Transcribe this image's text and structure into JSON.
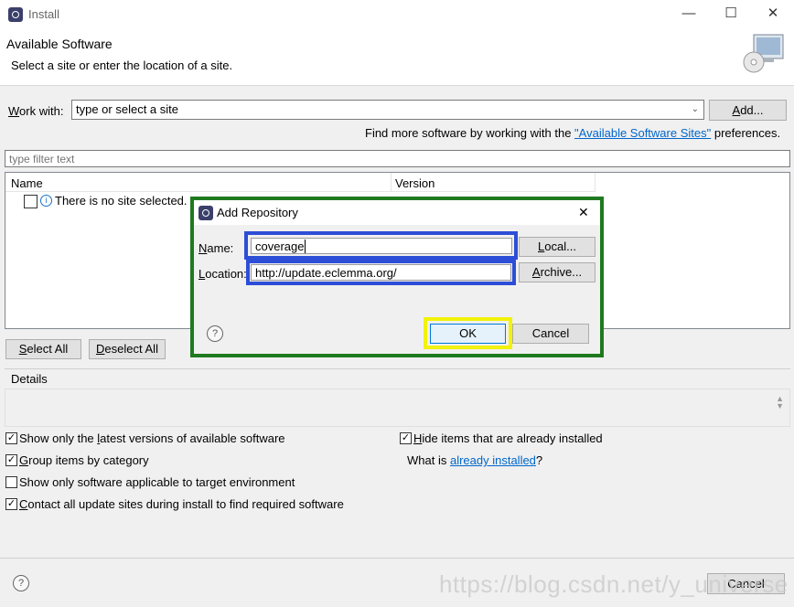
{
  "window": {
    "title": "Install",
    "minimize": "—",
    "maximize": "☐",
    "close": "✕"
  },
  "header": {
    "title": "Available Software",
    "subtitle": "Select a site or enter the location of a site."
  },
  "work_with": {
    "label_pre": "",
    "label_mnemonic": "W",
    "label_post": "ork with:",
    "value": "type or select a site",
    "add_mnemonic": "A",
    "add_post": "dd..."
  },
  "more_software": {
    "pre": "Find more software by working with the ",
    "link": "\"Available Software Sites\"",
    "post": " preferences."
  },
  "filter": {
    "placeholder": "type filter text"
  },
  "table": {
    "col_name": "Name",
    "col_version": "Version",
    "empty_message": "There is no site selected."
  },
  "select_all": {
    "mnemonic": "S",
    "post": "elect All"
  },
  "deselect_all": {
    "mnemonic": "D",
    "post": "eselect All"
  },
  "details": {
    "label": "Details"
  },
  "options": {
    "latest": {
      "pre": "Show only the ",
      "mnemonic": "l",
      "post": "atest versions of available software",
      "checked": "✓"
    },
    "group": {
      "pre": "",
      "mnemonic": "G",
      "post": "roup items by category",
      "checked": "✓"
    },
    "target": {
      "label": "Show only software applicable to target environment",
      "checked": ""
    },
    "contact": {
      "pre": "",
      "mnemonic": "C",
      "post": "ontact all update sites during install to find required software",
      "checked": "✓"
    },
    "hide": {
      "pre": "",
      "mnemonic": "H",
      "post": "ide items that are already installed",
      "checked": "✓"
    },
    "what_is": {
      "pre": "What is ",
      "link": "already installed",
      "post": "?"
    }
  },
  "dialog": {
    "title": "Add Repository",
    "name_mnemonic": "N",
    "name_post": "ame:",
    "name_value": "coverage",
    "location_mnemonic": "L",
    "location_post": "ocation:",
    "location_value": "http://update.eclemma.org/",
    "local_mnemonic": "L",
    "local_post": "ocal...",
    "archive_mnemonic": "A",
    "archive_post": "rchive...",
    "ok": "OK",
    "cancel": "Cancel",
    "help": "?",
    "close": "✕"
  },
  "footer": {
    "help": "?",
    "cancel": "Cancel",
    "watermark": "https://blog.csdn.net/y_universe"
  }
}
